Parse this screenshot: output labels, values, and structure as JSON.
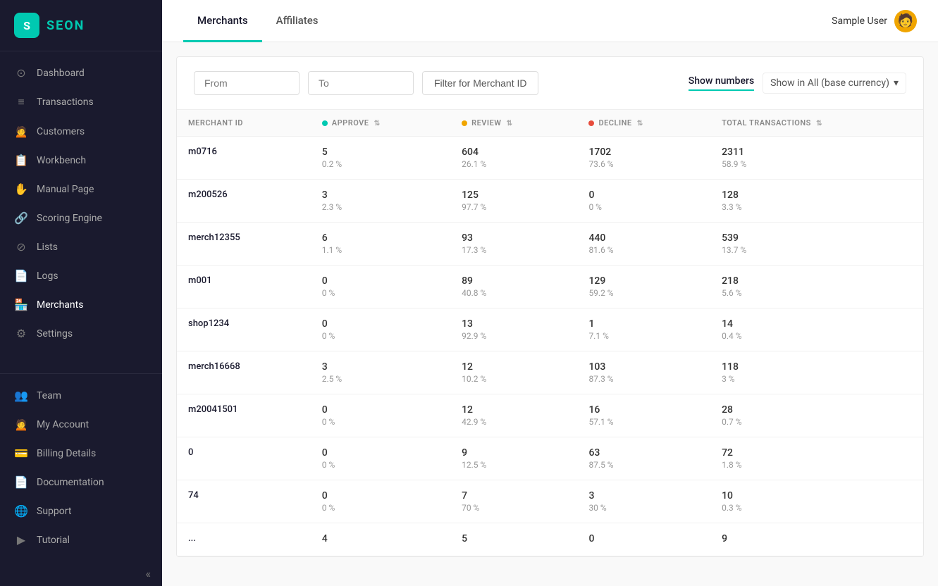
{
  "logo": {
    "icon": "S",
    "text": "SEON"
  },
  "sidebar": {
    "items": [
      {
        "id": "dashboard",
        "label": "Dashboard",
        "icon": "⊙",
        "active": false
      },
      {
        "id": "transactions",
        "label": "Transactions",
        "icon": "☰",
        "active": false
      },
      {
        "id": "customers",
        "label": "Customers",
        "icon": "👤",
        "active": false
      },
      {
        "id": "workbench",
        "label": "Workbench",
        "icon": "📋",
        "active": false
      },
      {
        "id": "manual-page",
        "label": "Manual Page",
        "icon": "✋",
        "active": false
      },
      {
        "id": "scoring-engine",
        "label": "Scoring Engine",
        "icon": "🔗",
        "active": false
      },
      {
        "id": "lists",
        "label": "Lists",
        "icon": "⊘",
        "active": false
      },
      {
        "id": "logs",
        "label": "Logs",
        "icon": "📄",
        "active": false
      },
      {
        "id": "merchants",
        "label": "Merchants",
        "icon": "🏪",
        "active": true
      },
      {
        "id": "settings",
        "label": "Settings",
        "icon": "⚙",
        "active": false
      }
    ],
    "bottom_items": [
      {
        "id": "team",
        "label": "Team",
        "icon": "👥"
      },
      {
        "id": "my-account",
        "label": "My Account",
        "icon": "👤"
      },
      {
        "id": "billing",
        "label": "Billing Details",
        "icon": "💳"
      },
      {
        "id": "documentation",
        "label": "Documentation",
        "icon": "📄"
      },
      {
        "id": "support",
        "label": "Support",
        "icon": "🌐"
      },
      {
        "id": "tutorial",
        "label": "Tutorial",
        "icon": "▶"
      }
    ],
    "collapse_icon": "«"
  },
  "top_nav": {
    "tabs": [
      {
        "id": "merchants",
        "label": "Merchants",
        "active": true
      },
      {
        "id": "affiliates",
        "label": "Affiliates",
        "active": false
      }
    ],
    "user": {
      "name": "Sample User",
      "avatar": "🧑"
    }
  },
  "filters": {
    "from_placeholder": "From",
    "to_placeholder": "To",
    "merchant_id_label": "Filter for Merchant ID",
    "show_numbers_label": "Show numbers",
    "currency_label": "Show in All (base currency)",
    "currency_arrow": "▾"
  },
  "table": {
    "columns": [
      {
        "id": "merchant-id",
        "label": "MERCHANT ID",
        "dot": null,
        "sortable": false
      },
      {
        "id": "approve",
        "label": "APPROVE",
        "dot": "green",
        "sortable": true
      },
      {
        "id": "review",
        "label": "REVIEW",
        "dot": "yellow",
        "sortable": true
      },
      {
        "id": "decline",
        "label": "DECLINE",
        "dot": "red",
        "sortable": true
      },
      {
        "id": "total",
        "label": "TOTAL TRANSACTIONS",
        "dot": null,
        "sortable": true
      }
    ],
    "rows": [
      {
        "id": "m0716",
        "approve": {
          "count": "5",
          "pct": "0.2 %"
        },
        "review": {
          "count": "604",
          "pct": "26.1 %"
        },
        "decline": {
          "count": "1702",
          "pct": "73.6 %"
        },
        "total": {
          "count": "2311",
          "pct": "58.9 %"
        }
      },
      {
        "id": "m200526",
        "approve": {
          "count": "3",
          "pct": "2.3 %"
        },
        "review": {
          "count": "125",
          "pct": "97.7 %"
        },
        "decline": {
          "count": "0",
          "pct": "0 %"
        },
        "total": {
          "count": "128",
          "pct": "3.3 %"
        }
      },
      {
        "id": "merch12355",
        "approve": {
          "count": "6",
          "pct": "1.1 %"
        },
        "review": {
          "count": "93",
          "pct": "17.3 %"
        },
        "decline": {
          "count": "440",
          "pct": "81.6 %"
        },
        "total": {
          "count": "539",
          "pct": "13.7 %"
        }
      },
      {
        "id": "m001",
        "approve": {
          "count": "0",
          "pct": "0 %"
        },
        "review": {
          "count": "89",
          "pct": "40.8 %"
        },
        "decline": {
          "count": "129",
          "pct": "59.2 %"
        },
        "total": {
          "count": "218",
          "pct": "5.6 %"
        }
      },
      {
        "id": "shop1234",
        "approve": {
          "count": "0",
          "pct": "0 %"
        },
        "review": {
          "count": "13",
          "pct": "92.9 %"
        },
        "decline": {
          "count": "1",
          "pct": "7.1 %"
        },
        "total": {
          "count": "14",
          "pct": "0.4 %"
        }
      },
      {
        "id": "merch16668",
        "approve": {
          "count": "3",
          "pct": "2.5 %"
        },
        "review": {
          "count": "12",
          "pct": "10.2 %"
        },
        "decline": {
          "count": "103",
          "pct": "87.3 %"
        },
        "total": {
          "count": "118",
          "pct": "3 %"
        }
      },
      {
        "id": "m20041501",
        "approve": {
          "count": "0",
          "pct": "0 %"
        },
        "review": {
          "count": "12",
          "pct": "42.9 %"
        },
        "decline": {
          "count": "16",
          "pct": "57.1 %"
        },
        "total": {
          "count": "28",
          "pct": "0.7 %"
        }
      },
      {
        "id": "0",
        "approve": {
          "count": "0",
          "pct": "0 %"
        },
        "review": {
          "count": "9",
          "pct": "12.5 %"
        },
        "decline": {
          "count": "63",
          "pct": "87.5 %"
        },
        "total": {
          "count": "72",
          "pct": "1.8 %"
        }
      },
      {
        "id": "74",
        "approve": {
          "count": "0",
          "pct": "0 %"
        },
        "review": {
          "count": "7",
          "pct": "70 %"
        },
        "decline": {
          "count": "3",
          "pct": "30 %"
        },
        "total": {
          "count": "10",
          "pct": "0.3 %"
        }
      },
      {
        "id": "...",
        "approve": {
          "count": "4",
          "pct": ""
        },
        "review": {
          "count": "5",
          "pct": ""
        },
        "decline": {
          "count": "0",
          "pct": ""
        },
        "total": {
          "count": "9",
          "pct": ""
        }
      }
    ]
  }
}
